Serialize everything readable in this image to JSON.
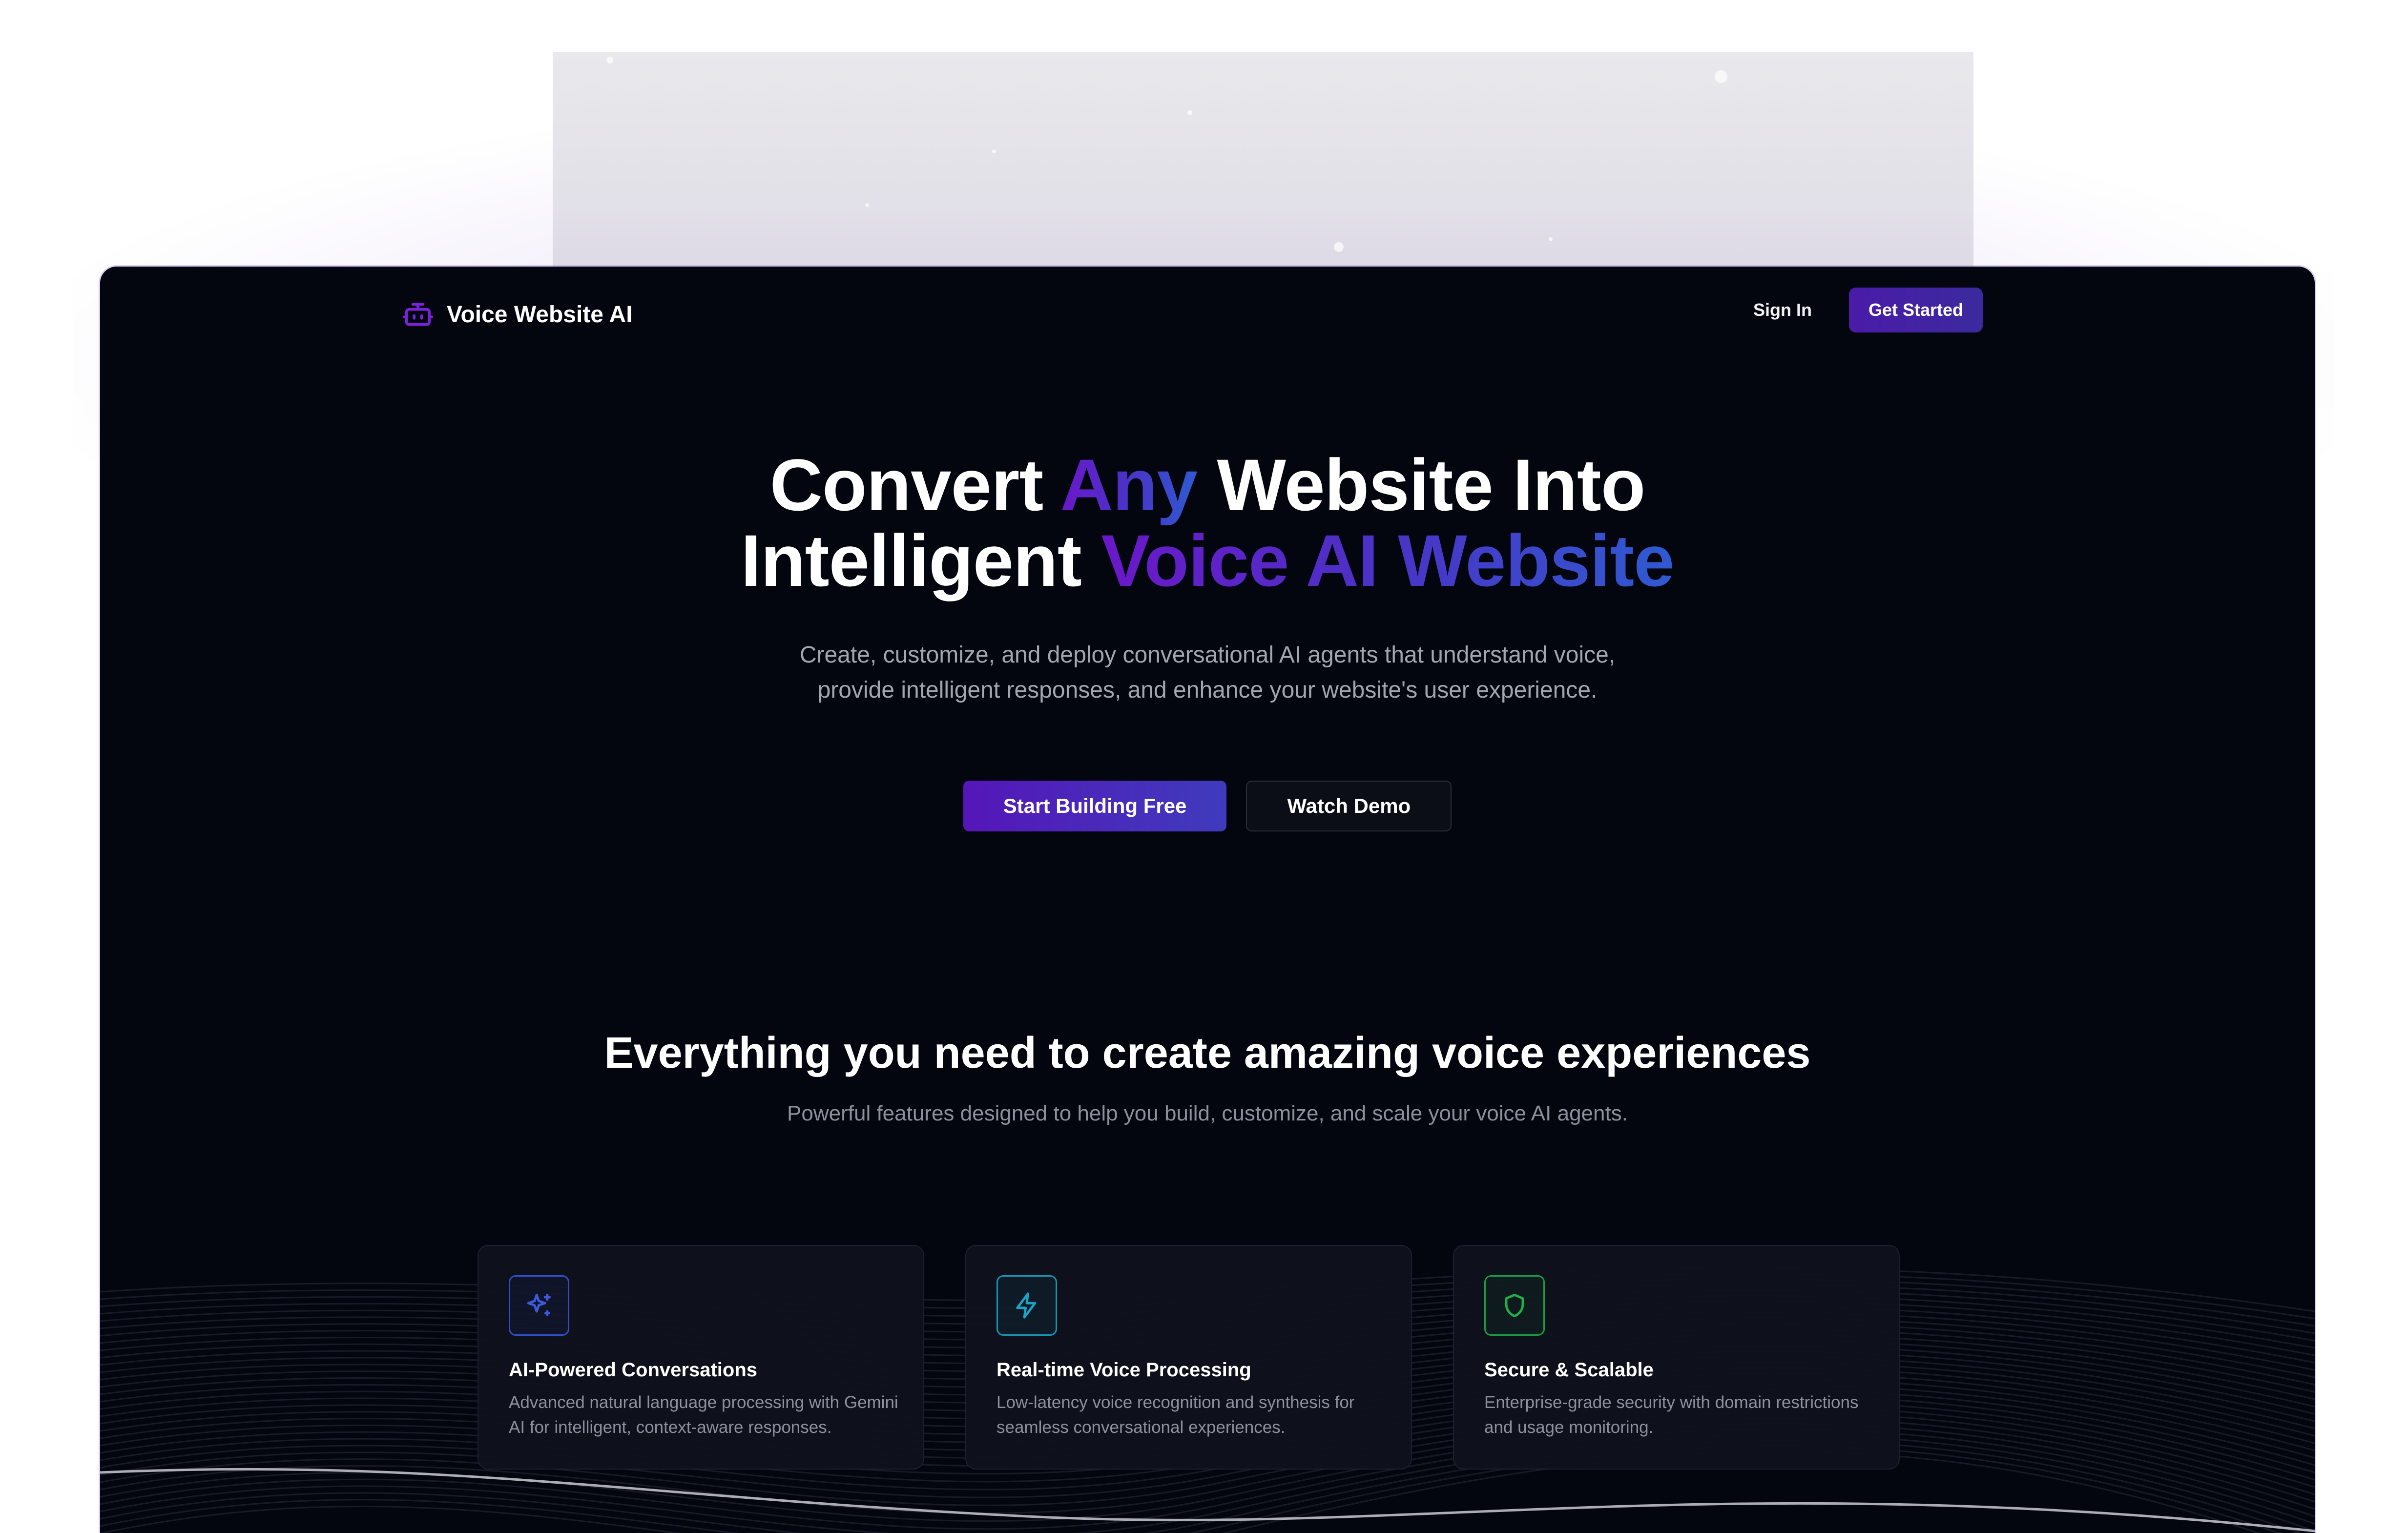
{
  "brand": {
    "name": "Voice Website AI",
    "icon": "robot-icon",
    "accent": "#6a18c9"
  },
  "nav": {
    "sign_in": "Sign In",
    "get_started": "Get Started"
  },
  "hero": {
    "title_part1": "Convert ",
    "title_highlight1": "Any",
    "title_part2": " Website Into",
    "title_part3": "Intelligent ",
    "title_highlight2": "Voice AI Website",
    "subtitle": "Create, customize, and deploy conversational AI agents that understand voice, provide intelligent responses, and enhance your website's user experience.",
    "primary_button": "Start Building Free",
    "secondary_button": "Watch Demo"
  },
  "features": {
    "title": "Everything you need to create amazing voice experiences",
    "subtitle": "Powerful features designed to help you build, customize, and scale your voice AI agents.",
    "cards": [
      {
        "icon": "sparkles-icon",
        "color": "#3b5bdb",
        "title": "AI-Powered Conversations",
        "description": "Advanced natural language processing with Gemini AI for intelligent, context-aware responses."
      },
      {
        "icon": "lightning-icon",
        "color": "#1ba3c6",
        "title": "Real-time Voice Processing",
        "description": "Low-latency voice recognition and synthesis for seamless conversational experiences."
      },
      {
        "icon": "shield-icon",
        "color": "#1fae4a",
        "title": "Secure & Scalable",
        "description": "Enterprise-grade security with domain restrictions and usage monitoring."
      }
    ]
  }
}
